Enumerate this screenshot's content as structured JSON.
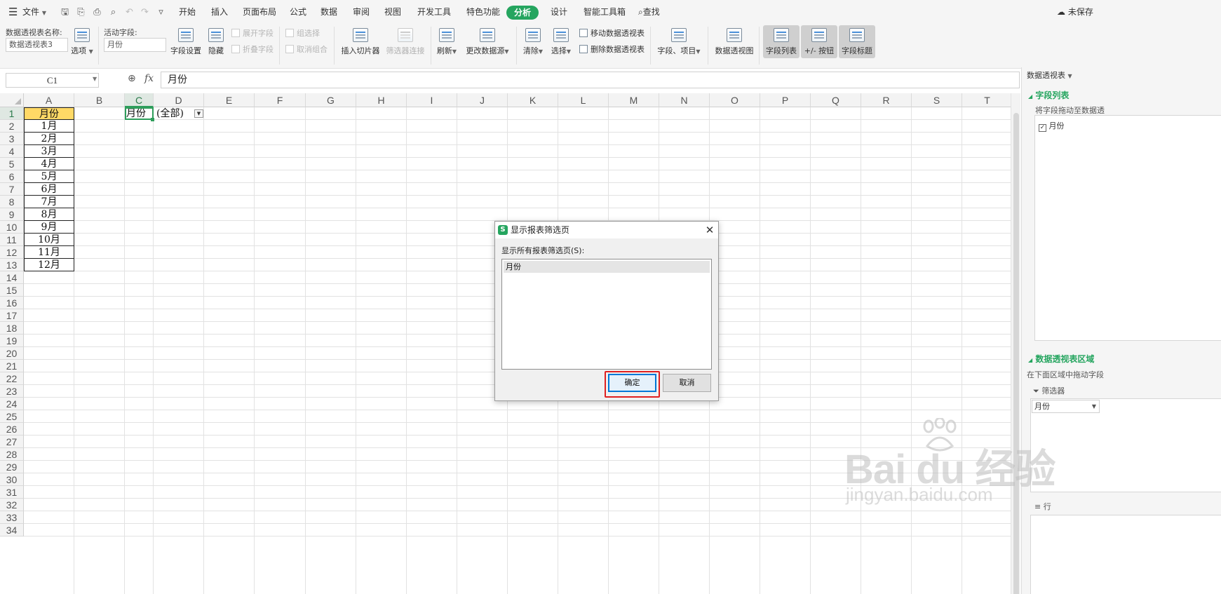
{
  "menubar": {
    "file_label": "文件",
    "tabs": [
      "开始",
      "插入",
      "页面布局",
      "公式",
      "数据",
      "审阅",
      "视图",
      "开发工具",
      "特色功能",
      "分析",
      "设计",
      "智能工具箱"
    ],
    "active_tab": "分析",
    "search_label": "查找",
    "unsaved_label": "未保存"
  },
  "ribbon": {
    "pivot_name_label": "数据透视表名称:",
    "pivot_name_value": "数据透视表3",
    "options_label": "选项",
    "active_field_label": "活动字段:",
    "active_field_value": "月份",
    "field_settings_label": "字段设置",
    "hide_label": "隐藏",
    "expand_field_label": "展开字段",
    "collapse_field_label": "折叠字段",
    "group_select_label": "组选择",
    "ungroup_label": "取消组合",
    "insert_slicer_label": "插入切片器",
    "filter_connect_label": "筛选器连接",
    "refresh_label": "刷新",
    "change_source_label": "更改数据源",
    "clear_label": "清除",
    "select_label": "选择",
    "move_pivot_label": "移动数据透视表",
    "delete_pivot_label": "删除数据透视表",
    "fields_items_label": "字段、项目",
    "pivot_chart_label": "数据透视图",
    "field_list_label": "字段列表",
    "buttons_label": "+/- 按钮",
    "field_headers_label": "字段标题"
  },
  "formula_bar": {
    "name_box": "C1",
    "fx_label": "fx",
    "content": "月份"
  },
  "sheet": {
    "columns": [
      "A",
      "B",
      "C",
      "D",
      "E",
      "F",
      "G",
      "H",
      "I",
      "J",
      "K",
      "L",
      "M",
      "N",
      "O",
      "P",
      "Q",
      "R",
      "S",
      "T"
    ],
    "rows": [
      "1",
      "2",
      "3",
      "4",
      "5",
      "6",
      "7",
      "8",
      "9",
      "10",
      "11",
      "12",
      "13",
      "14",
      "15",
      "16",
      "17",
      "18",
      "19",
      "20",
      "21",
      "22",
      "23",
      "24",
      "25",
      "26",
      "27",
      "28",
      "29",
      "30",
      "31",
      "32",
      "33",
      "34"
    ],
    "selected_column": "C",
    "selected_row": "1",
    "col_a_values": [
      "月份",
      "1月",
      "2月",
      "3月",
      "4月",
      "5月",
      "6月",
      "7月",
      "8月",
      "9月",
      "10月",
      "11月",
      "12月"
    ],
    "c1_value": "月份",
    "d1_value": "(全部)",
    "header_fill_color": "#ffd966",
    "selection_color": "#2e9e5b"
  },
  "pane": {
    "header_label": "数据透视表",
    "field_list_title": "字段列表",
    "field_list_hint": "将字段拖动至数据透",
    "field_item_label": "月份",
    "field_item_checked": true,
    "area_title": "数据透视表区域",
    "area_hint": "在下面区域中拖动字段",
    "filter_label": "筛选器",
    "filter_value": "月份",
    "rows_label": "行"
  },
  "dialog": {
    "title": "显示报表筛选页",
    "prompt": "显示所有报表筛选页(S):",
    "list_items": [
      "月份"
    ],
    "ok_label": "确定",
    "cancel_label": "取消",
    "highlight_color": "#e02020"
  },
  "watermark": {
    "big_text": "Bai  du 经验",
    "small_text": "jingyan.baidu.com"
  }
}
